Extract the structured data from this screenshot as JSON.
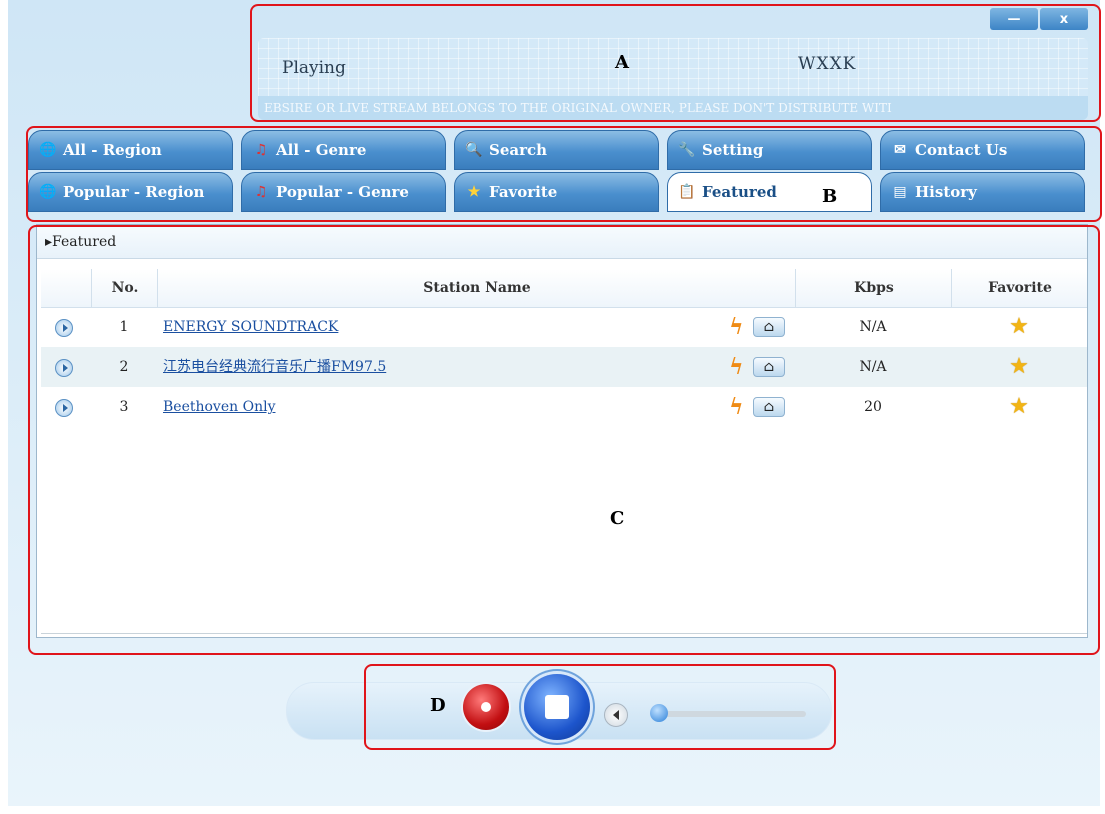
{
  "window": {
    "minimize_label": "—",
    "close_label": "x"
  },
  "player": {
    "status": "Playing",
    "station": "WXXK",
    "ticker": "EBSIRE OR LIVE STREAM BELONGS TO THE ORIGINAL OWNER, PLEASE DON'T DISTRIBUTE WITI"
  },
  "tabs": {
    "row1": [
      {
        "label": "All - Region",
        "icon": "globe-icon"
      },
      {
        "label": "All - Genre",
        "icon": "music-note-icon"
      },
      {
        "label": "Search",
        "icon": "magnifier-icon"
      },
      {
        "label": "Setting",
        "icon": "wrench-icon"
      },
      {
        "label": "Contact Us",
        "icon": "envelope-icon"
      }
    ],
    "row2": [
      {
        "label": "Popular - Region",
        "icon": "globe-star-icon"
      },
      {
        "label": "Popular - Genre",
        "icon": "music-star-icon"
      },
      {
        "label": "Favorite",
        "icon": "star-icon"
      },
      {
        "label": "Featured",
        "icon": "featured-icon",
        "active": true
      },
      {
        "label": "History",
        "icon": "history-icon"
      }
    ]
  },
  "list": {
    "breadcrumb": "▸Featured",
    "columns": {
      "no": "No.",
      "name": "Station Name",
      "kbps": "Kbps",
      "favorite": "Favorite"
    },
    "rows": [
      {
        "no": "1",
        "name": "ENERGY SOUNDTRACK",
        "kbps": "N/A"
      },
      {
        "no": "2",
        "name": "江苏电台经典流行音乐广播FM97.5",
        "kbps": "N/A"
      },
      {
        "no": "3",
        "name": "Beethoven Only",
        "kbps": "20"
      }
    ]
  },
  "controls": {
    "volume_level": 0.05
  },
  "annotations": {
    "a": "A",
    "b": "B",
    "c": "C",
    "d": "D"
  },
  "colors": {
    "annotation": "#e0141a",
    "tab": "#4a8fce",
    "link": "#1a4fa0"
  }
}
